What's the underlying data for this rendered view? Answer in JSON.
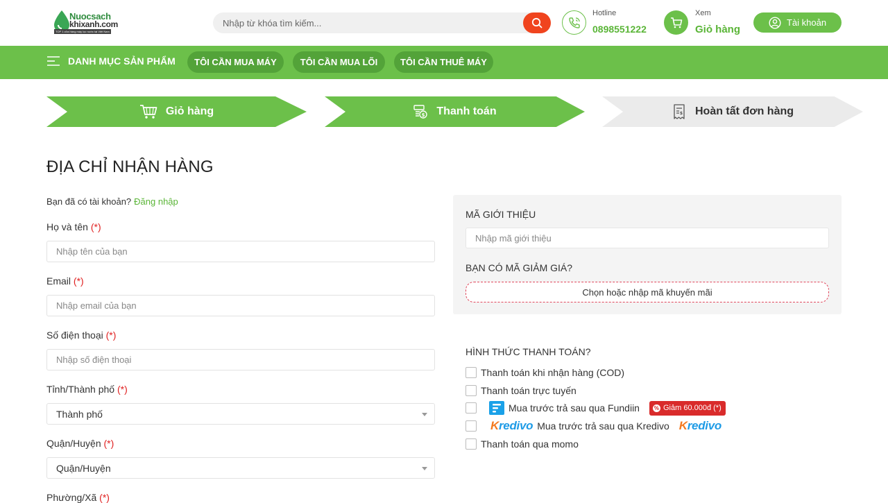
{
  "header": {
    "logo_line1": "Nuocsach",
    "logo_line2": "khixanh.com",
    "logo_tagline": "TOP 1 cửa hàng máy lọc nước tại Việt Nam",
    "search_placeholder": "Nhập từ khóa tìm kiếm...",
    "hotline_label": "Hotline",
    "hotline_number": "0898551222",
    "cart_label": "Xem",
    "cart_text": "Giỏ hàng",
    "account_label": "Tài khoản"
  },
  "nav": {
    "category_label": "DANH MỤC SẢN PHẨM",
    "pills": [
      "TÔI CẦN MUA MÁY",
      "TÔI CẦN MUA LÕI",
      "TÔI CẦN THUÊ MÁY"
    ]
  },
  "steps": [
    {
      "label": "Giỏ hàng",
      "state": "active"
    },
    {
      "label": "Thanh toán",
      "state": "active"
    },
    {
      "label": "Hoàn tất đơn hàng",
      "state": "inactive"
    }
  ],
  "form": {
    "title": "ĐỊA CHỈ NHẬN HÀNG",
    "login_prompt": "Bạn đã có tài khoản?",
    "login_link": "Đăng nhập",
    "required_mark": "(*)",
    "fields": [
      {
        "label": "Họ và tên",
        "placeholder": "Nhập tên của bạn"
      },
      {
        "label": "Email",
        "placeholder": "Nhập email của bạn"
      },
      {
        "label": "Số điện thoại",
        "placeholder": "Nhập số điện thoại"
      },
      {
        "label": "Tỉnh/Thành phố",
        "value": "Thành phố"
      },
      {
        "label": "Quận/Huyện",
        "value": "Quận/Huyện"
      },
      {
        "label": "Phường/Xã"
      }
    ]
  },
  "referral": {
    "heading": "MÃ GIỚI THIỆU",
    "placeholder": "Nhập mã giới thiệu",
    "coupon_heading": "BẠN CÓ MÃ GIẢM GIÁ?",
    "coupon_button": "Chọn hoặc nhập mã khuyến mãi"
  },
  "payment": {
    "heading": "HÌNH THỨC THANH TOÁN?",
    "options": [
      {
        "label": "Thanh toán khi nhận hàng (COD)"
      },
      {
        "label": "Thanh toán trực tuyến"
      },
      {
        "label": "Mua trước trả sau qua Fundiin",
        "promo": "Giảm 60.000đ (*)"
      },
      {
        "label": "Mua trước trả sau qua Kredivo",
        "brand": "redivo"
      },
      {
        "label": "Thanh toán qua momo"
      }
    ]
  },
  "colors": {
    "brand_green": "#6cc04a",
    "dark_green_pill": "#53a339",
    "search_button": "#f0441e",
    "required_red": "#e02020",
    "promo_red": "#d92b2b"
  }
}
